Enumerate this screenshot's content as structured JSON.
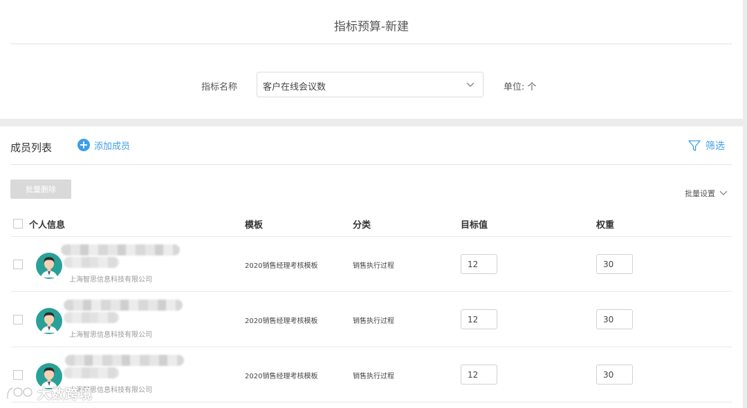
{
  "page": {
    "title": "指标预算-新建"
  },
  "form": {
    "metric_label": "指标名称",
    "metric_value": "客户在线会议数",
    "unit_text": "单位:  个"
  },
  "members": {
    "title": "成员列表",
    "add_label": "添加成员",
    "filter_label": "筛选",
    "batch_delete_label": "批量删除",
    "batch_settings_label": "批量设置"
  },
  "table": {
    "headers": {
      "info": "个人信息",
      "template": "模板",
      "category": "分类",
      "target": "目标值",
      "weight": "权重"
    },
    "rows": [
      {
        "company": "上海智思信息科技有限公司",
        "template": "2020销售经理考核模板",
        "category": "销售执行过程",
        "target": "12",
        "weight": "30"
      },
      {
        "company": "上海智思信息科技有限公司",
        "template": "2020销售经理考核模板",
        "category": "销售执行过程",
        "target": "12",
        "weight": "30"
      },
      {
        "company": "上海智思信息科技有限公司",
        "template": "2020销售经理考核模板",
        "category": "销售执行过程",
        "target": "12",
        "weight": "30"
      }
    ]
  },
  "watermark": {
    "text": "大数跨境"
  },
  "colors": {
    "accent": "#3d9ee8",
    "avatar_bg": "#2aa198",
    "disabled_button": "#d9d9d9"
  }
}
